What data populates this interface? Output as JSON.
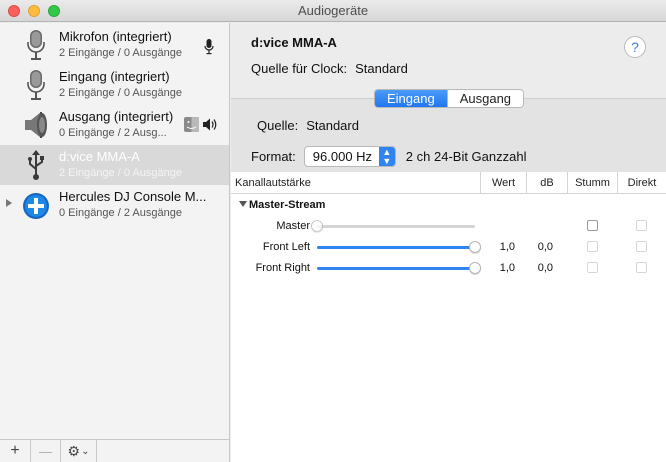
{
  "window": {
    "title": "Audiogeräte"
  },
  "devices": [
    {
      "name": "Mikrofon (integriert)",
      "io": "2 Eingänge / 0 Ausgänge",
      "icon": "microphone-icon",
      "badge": "microphone-badge-icon"
    },
    {
      "name": "Eingang (integriert)",
      "io": "2 Eingänge / 0 Ausgänge",
      "icon": "microphone-icon"
    },
    {
      "name": "Ausgang (integriert)",
      "io": "0 Eingänge / 2 Ausg...",
      "icon": "speaker-icon",
      "badges": [
        "finder-icon",
        "speaker-volume-icon"
      ]
    },
    {
      "name": "d:vice MMA-A",
      "io": "2 Eingänge / 0 Ausgänge",
      "icon": "usb-icon",
      "selected": true
    },
    {
      "name": "Hercules DJ Console M...",
      "io": "0 Eingänge / 2 Ausgänge",
      "icon": "aggregate-plus-icon",
      "expandable": true
    }
  ],
  "toolbar": {
    "add": "+",
    "remove": "—",
    "gear": "⚙",
    "chevron": "⌄"
  },
  "detail": {
    "device_title": "d:vice MMA-A",
    "clock_label": "Quelle für Clock:",
    "clock_value": "Standard",
    "help": "?",
    "tabs": [
      {
        "label": "Eingang",
        "active": true
      },
      {
        "label": "Ausgang",
        "active": false
      }
    ],
    "source_label": "Quelle:",
    "source_value": "Standard",
    "format_label": "Format:",
    "format_value": "96.000 Hz",
    "format_desc": "2 ch 24-Bit Ganzzahl"
  },
  "table": {
    "columns": [
      "Kanallautstärke",
      "Wert",
      "dB",
      "Stumm",
      "Direkt"
    ],
    "group": "Master-Stream",
    "rows": [
      {
        "label": "Master",
        "level": 0.0,
        "wert": "",
        "db": "",
        "muted": false,
        "enabled": false
      },
      {
        "label": "Front Left",
        "level": 1.0,
        "wert": "1,0",
        "db": "0,0",
        "muted": false,
        "enabled": true
      },
      {
        "label": "Front Right",
        "level": 1.0,
        "wert": "1,0",
        "db": "0,0",
        "muted": false,
        "enabled": true
      }
    ]
  },
  "colors": {
    "accent": "#2f84f2",
    "selection": "#d9d9d9"
  }
}
